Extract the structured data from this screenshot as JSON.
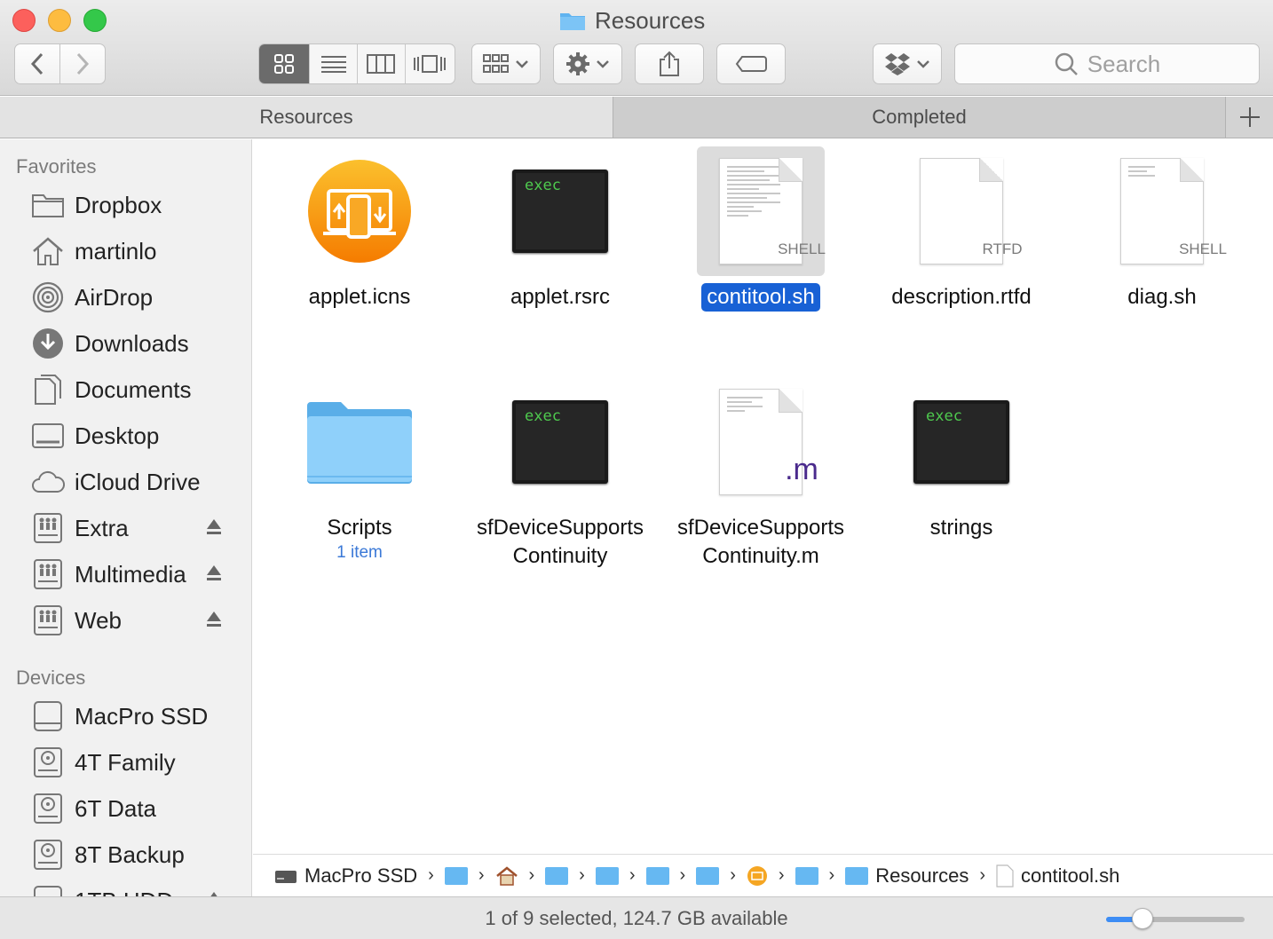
{
  "window": {
    "title": "Resources"
  },
  "toolbar": {
    "back_icon": "chevron-left-icon",
    "forward_icon": "chevron-right-icon",
    "view_modes": [
      "icon-view",
      "list-view",
      "column-view",
      "cover-flow-view"
    ],
    "active_view": "icon-view",
    "search_placeholder": "Search"
  },
  "tabs": [
    {
      "label": "Resources",
      "active": true
    },
    {
      "label": "Completed",
      "active": false
    }
  ],
  "sidebar": {
    "favorites_heading": "Favorites",
    "favorites": [
      {
        "label": "Dropbox",
        "icon": "folder-icon"
      },
      {
        "label": "martinlo",
        "icon": "home-icon"
      },
      {
        "label": "AirDrop",
        "icon": "airdrop-icon"
      },
      {
        "label": "Downloads",
        "icon": "downloads-icon"
      },
      {
        "label": "Documents",
        "icon": "documents-icon"
      },
      {
        "label": "Desktop",
        "icon": "desktop-icon"
      },
      {
        "label": "iCloud Drive",
        "icon": "cloud-icon"
      },
      {
        "label": "Extra",
        "icon": "network-drive-icon",
        "eject": true
      },
      {
        "label": "Multimedia",
        "icon": "network-drive-icon",
        "eject": true
      },
      {
        "label": "Web",
        "icon": "network-drive-icon",
        "eject": true
      }
    ],
    "devices_heading": "Devices",
    "devices": [
      {
        "label": "MacPro SSD",
        "icon": "drive-icon"
      },
      {
        "label": "4T Family",
        "icon": "hard-disk-icon"
      },
      {
        "label": "6T Data",
        "icon": "hard-disk-icon"
      },
      {
        "label": "8T Backup",
        "icon": "hard-disk-icon"
      },
      {
        "label": "1TB HDD",
        "icon": "drive-icon",
        "eject": true
      }
    ]
  },
  "files": [
    {
      "name": "applet.icns",
      "kind": "icns",
      "selected": false
    },
    {
      "name": "applet.rsrc",
      "kind": "exec",
      "badge": "exec",
      "selected": false
    },
    {
      "name": "contitool.sh",
      "kind": "doc-lines",
      "badge": "SHELL",
      "selected": true
    },
    {
      "name": "description.rtfd",
      "kind": "doc",
      "badge": "RTFD",
      "selected": false
    },
    {
      "name": "diag.sh",
      "kind": "doc-lines",
      "badge": "SHELL",
      "selected": false
    },
    {
      "name": "Scripts",
      "kind": "folder",
      "subtitle": "1 item",
      "selected": false
    },
    {
      "name_line1": "sfDeviceSupports",
      "name_line2": "Continuity",
      "kind": "exec",
      "badge": "exec",
      "selected": false
    },
    {
      "name_line1": "sfDeviceSupports",
      "name_line2": "Continuity.m",
      "kind": "doc-ext",
      "badge": ".m",
      "selected": false
    },
    {
      "name": "strings",
      "kind": "exec",
      "badge": "exec",
      "selected": false
    }
  ],
  "pathbar": {
    "root": "MacPro SSD",
    "parent": "Resources",
    "current": "contitool.sh"
  },
  "status": {
    "text": "1 of 9 selected, 124.7 GB available",
    "zoom_fraction": 0.26
  },
  "colors": {
    "selection": "#1861d5",
    "folder": "#66b8f2",
    "icns": "#f39c12"
  }
}
